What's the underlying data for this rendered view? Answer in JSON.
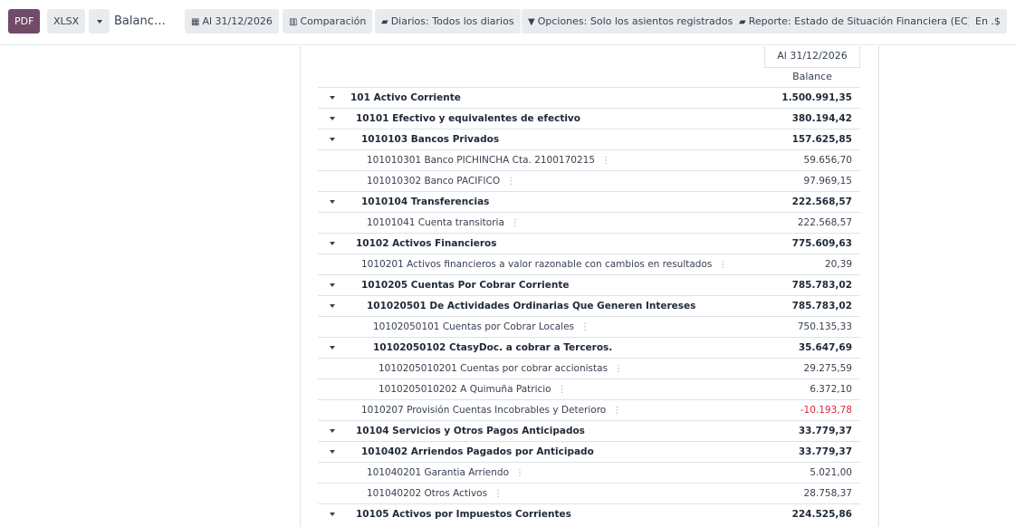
{
  "toolbar": {
    "pdf": "PDF",
    "xlsx": "XLSX",
    "title": "Balanc…",
    "date_filter": "Al 31/12/2026",
    "comparison": "Comparación",
    "journals": "Diarios: Todos los diarios",
    "options": "Opciones: Solo los asientos registrados",
    "report": "Reporte: Estado de Situación Financiera (EC)",
    "currency": "En .$"
  },
  "report": {
    "column_date": "Al 31/12/2026",
    "column_label": "Balance",
    "rows": [
      {
        "name": "101 Activo Corriente",
        "value": "1.500.991,35",
        "level": 0,
        "bold": true,
        "expandable": true
      },
      {
        "name": "10101 Efectivo y equivalentes de efectivo",
        "value": "380.194,42",
        "level": 1,
        "bold": true,
        "expandable": true
      },
      {
        "name": "1010103 Bancos Privados",
        "value": "157.625,85",
        "level": 2,
        "bold": true,
        "expandable": true
      },
      {
        "name": "101010301 Banco PICHINCHA Cta. 2100170215",
        "value": "59.656,70",
        "level": 3,
        "bold": false,
        "expandable": false
      },
      {
        "name": "101010302 Banco PACIFICO",
        "value": "97.969,15",
        "level": 3,
        "bold": false,
        "expandable": false
      },
      {
        "name": "1010104 Transferencias",
        "value": "222.568,57",
        "level": 2,
        "bold": true,
        "expandable": true
      },
      {
        "name": "10101041 Cuenta transitoria",
        "value": "222.568,57",
        "level": 3,
        "bold": false,
        "expandable": false
      },
      {
        "name": "10102 Activos Financieros",
        "value": "775.609,63",
        "level": 1,
        "bold": true,
        "expandable": true
      },
      {
        "name": "1010201 Activos financieros a valor razonable con cambios en resultados",
        "value": "20,39",
        "level": 2,
        "bold": false,
        "expandable": false
      },
      {
        "name": "1010205 Cuentas Por Cobrar Corriente",
        "value": "785.783,02",
        "level": 2,
        "bold": true,
        "expandable": true
      },
      {
        "name": "101020501 De Actividades Ordinarias Que Generen Intereses",
        "value": "785.783,02",
        "level": 3,
        "bold": true,
        "expandable": true
      },
      {
        "name": "10102050101 Cuentas por Cobrar Locales",
        "value": "750.135,33",
        "level": 4,
        "bold": false,
        "expandable": false
      },
      {
        "name": "10102050102 CtasyDoc. a cobrar a Terceros.",
        "value": "35.647,69",
        "level": 4,
        "bold": true,
        "expandable": true
      },
      {
        "name": "1010205010201 Cuentas por cobrar accionistas",
        "value": "29.275,59",
        "level": 5,
        "bold": false,
        "expandable": false
      },
      {
        "name": "1010205010202 A Quimuña Patricio",
        "value": "6.372,10",
        "level": 5,
        "bold": false,
        "expandable": false
      },
      {
        "name": "1010207 Provisión Cuentas Incobrables y Deterioro",
        "value": "-10.193,78",
        "level": 2,
        "bold": false,
        "expandable": false,
        "negative": true
      },
      {
        "name": "10104 Servicios y Otros Pagos Anticipados",
        "value": "33.779,37",
        "level": 1,
        "bold": true,
        "expandable": true
      },
      {
        "name": "1010402 Arriendos Pagados por Anticipado",
        "value": "33.779,37",
        "level": 2,
        "bold": true,
        "expandable": true
      },
      {
        "name": "101040201 Garantia Arriendo",
        "value": "5.021,00",
        "level": 3,
        "bold": false,
        "expandable": false
      },
      {
        "name": "101040202 Otros Activos",
        "value": "28.758,37",
        "level": 3,
        "bold": false,
        "expandable": false
      },
      {
        "name": "10105 Activos por Impuestos Corrientes",
        "value": "224.525,86",
        "level": 1,
        "bold": true,
        "expandable": true
      }
    ]
  },
  "colors": {
    "primary": "#714b67",
    "negative": "#d9283b",
    "button_bg": "#e9ecef"
  }
}
